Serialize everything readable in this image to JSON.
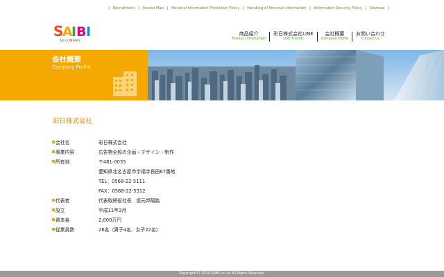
{
  "utility_links": [
    "Recruitment",
    "Access Map",
    "Personal Information Protection Policy",
    "Handling of Personal Information",
    "Information Security Policy",
    "Sitemap"
  ],
  "logo": {
    "text": "SAIBI",
    "sub": "AD COMPANY"
  },
  "nav": [
    {
      "jp": "商品紹介",
      "en": "Product Introduction"
    },
    {
      "jp": "彩日株式会社LINE",
      "en": "LINE Friends"
    },
    {
      "jp": "会社概要",
      "en": "Company Profile"
    },
    {
      "jp": "お問い合わせ",
      "en": "Contact Us"
    }
  ],
  "hero": {
    "title": "会社概要",
    "subtitle": "Company Profile"
  },
  "section_title": "彩日株式会社",
  "info": [
    {
      "label": "会社名",
      "value": "彩日株式会社"
    },
    {
      "label": "事業内容",
      "value": "広告物全般の企画・デザイン・制作"
    },
    {
      "label": "所在地",
      "value": "〒481-0035"
    },
    {
      "label": "",
      "value": "愛知県北名古屋市宇福寺長田67番地"
    },
    {
      "label": "",
      "value": "TEL：0568-22-5111"
    },
    {
      "label": "",
      "value": "FAX：0568-22-5312"
    },
    {
      "label": "代表者",
      "value": "代表取締役社長　坂元邦陽路"
    },
    {
      "label": "設立",
      "value": "平成11年3月"
    },
    {
      "label": "資本金",
      "value": "2,000万円"
    },
    {
      "label": "従業員数",
      "value": "26名（男子4名、女子22名）"
    }
  ],
  "footer": "Copyright(C) 2018 SAIBI co.Ltd All Rights Reserved.",
  "colors": {
    "accent": "#f5a800",
    "title": "#f08c00",
    "nav_en": "#5aa02c",
    "footer": "#9a9a9a"
  }
}
